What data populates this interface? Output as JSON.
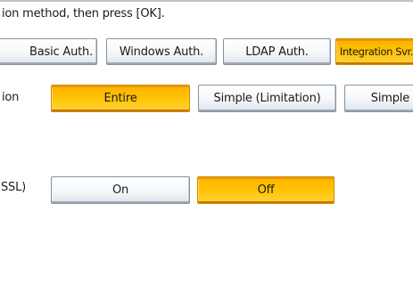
{
  "instruction": "ion method, then press [OK].",
  "auth_tabs": [
    {
      "label": "Basic Auth.",
      "selected": false
    },
    {
      "label": "Windows Auth.",
      "selected": false
    },
    {
      "label": "LDAP Auth.",
      "selected": false
    },
    {
      "label": "Integration Svr.",
      "selected": true
    }
  ],
  "scope_row": {
    "label": "ion",
    "options": [
      {
        "label": "Entire",
        "selected": true
      },
      {
        "label": "Simple (Limitation)",
        "selected": false
      },
      {
        "label": "Simple",
        "selected": false
      }
    ]
  },
  "ssl_row": {
    "label": "SSL)",
    "options": [
      {
        "label": "On",
        "selected": false
      },
      {
        "label": "Off",
        "selected": true
      }
    ]
  },
  "colors": {
    "selected_fill": "#ffc200",
    "selected_border": "#d58a00",
    "button_border": "#86929c",
    "rule": "#bfc3c6"
  }
}
